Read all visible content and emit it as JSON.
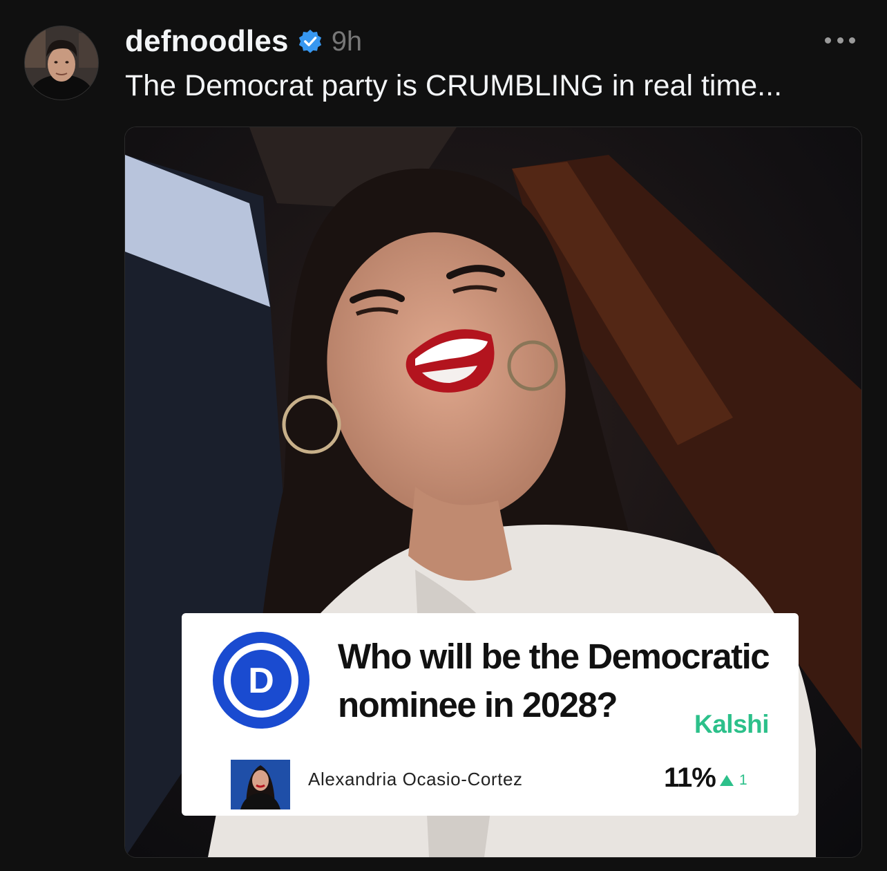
{
  "post": {
    "username": "defnoodles",
    "time": "9h",
    "caption": "The Democrat party is CRUMBLING in real time...",
    "verified_color": "#3797f0"
  },
  "icons": {
    "verified": "verified-badge-icon",
    "more": "more-options-icon"
  },
  "card": {
    "question": "Who will be the Democratic nominee in 2028?",
    "brand": "Kalshi",
    "brand_color": "#2cc08a",
    "party_logo_letter": "D",
    "party_logo_color": "#1a4bd0",
    "candidate": {
      "name": "Alexandria Ocasio-Cortez",
      "percent": "11%",
      "change": "1",
      "change_direction": "up"
    }
  }
}
